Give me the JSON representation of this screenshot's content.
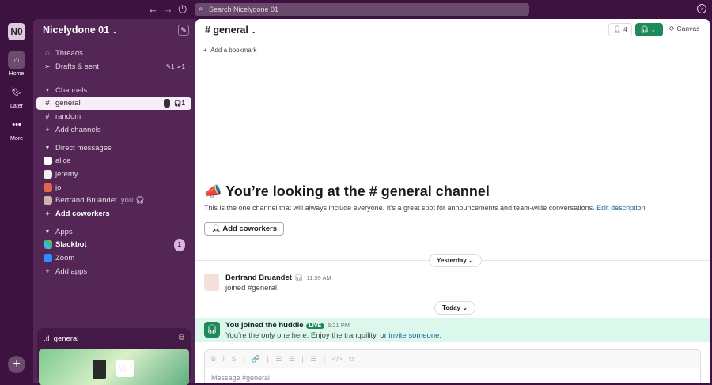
{
  "topbar": {
    "search_placeholder": "Search Nicelydone 01",
    "back": "←",
    "forward": "→",
    "history": "◷",
    "help": "?"
  },
  "rail": {
    "workspace": "N0",
    "home": "Home",
    "later": "Later",
    "more": "More",
    "add": "+"
  },
  "sidebar": {
    "workspace_name": "Nicelydone 01",
    "threads": "Threads",
    "drafts": "Drafts & sent",
    "drafts_counts": "✎1  ➢1",
    "channels_header": "Channels",
    "channels": [
      {
        "name": "general",
        "huddle_count": "1"
      },
      {
        "name": "random"
      }
    ],
    "add_channels": "Add channels",
    "dm_header": "Direct messages",
    "dms": [
      {
        "name": "alice"
      },
      {
        "name": "jeremy"
      },
      {
        "name": "jo"
      },
      {
        "name": "Bertrand Bruandet",
        "suffix": "you"
      }
    ],
    "add_coworkers": "Add coworkers",
    "apps_header": "Apps",
    "apps": [
      {
        "name": "Slackbot",
        "badge": "1"
      },
      {
        "name": "Zoom"
      }
    ],
    "add_apps": "Add apps",
    "huddle_channel": "general"
  },
  "main": {
    "channel": "# general",
    "member_count": "4",
    "canvas": "Canvas",
    "add_bookmark": "Add a bookmark",
    "intro_title": "📣 You’re looking at the # general channel",
    "intro_text": "This is the one channel that will always include everyone. It’s a great spot for announcements and team-wide conversations.",
    "edit_description": "Edit description",
    "add_coworkers": "Add coworkers",
    "date1": "Yesterday",
    "date2": "Today",
    "message": {
      "author": "Bertrand Bruandet",
      "time": "11:59 AM",
      "text": "joined #general."
    },
    "huddle": {
      "title": "You joined the huddle",
      "live": "LIVE",
      "time": "6:21 PM",
      "text": "You’re the only one here. Enjoy the tranquility, or ",
      "link": "invite someone."
    },
    "composer_placeholder": "Message #general",
    "toolbar": "B I S | 🔗 | ☰ ☰ | ☰ | </> ⧉"
  },
  "colors": {
    "accent": "#1e8a5a",
    "sidebar": "#532656",
    "frame": "#3d1240"
  }
}
